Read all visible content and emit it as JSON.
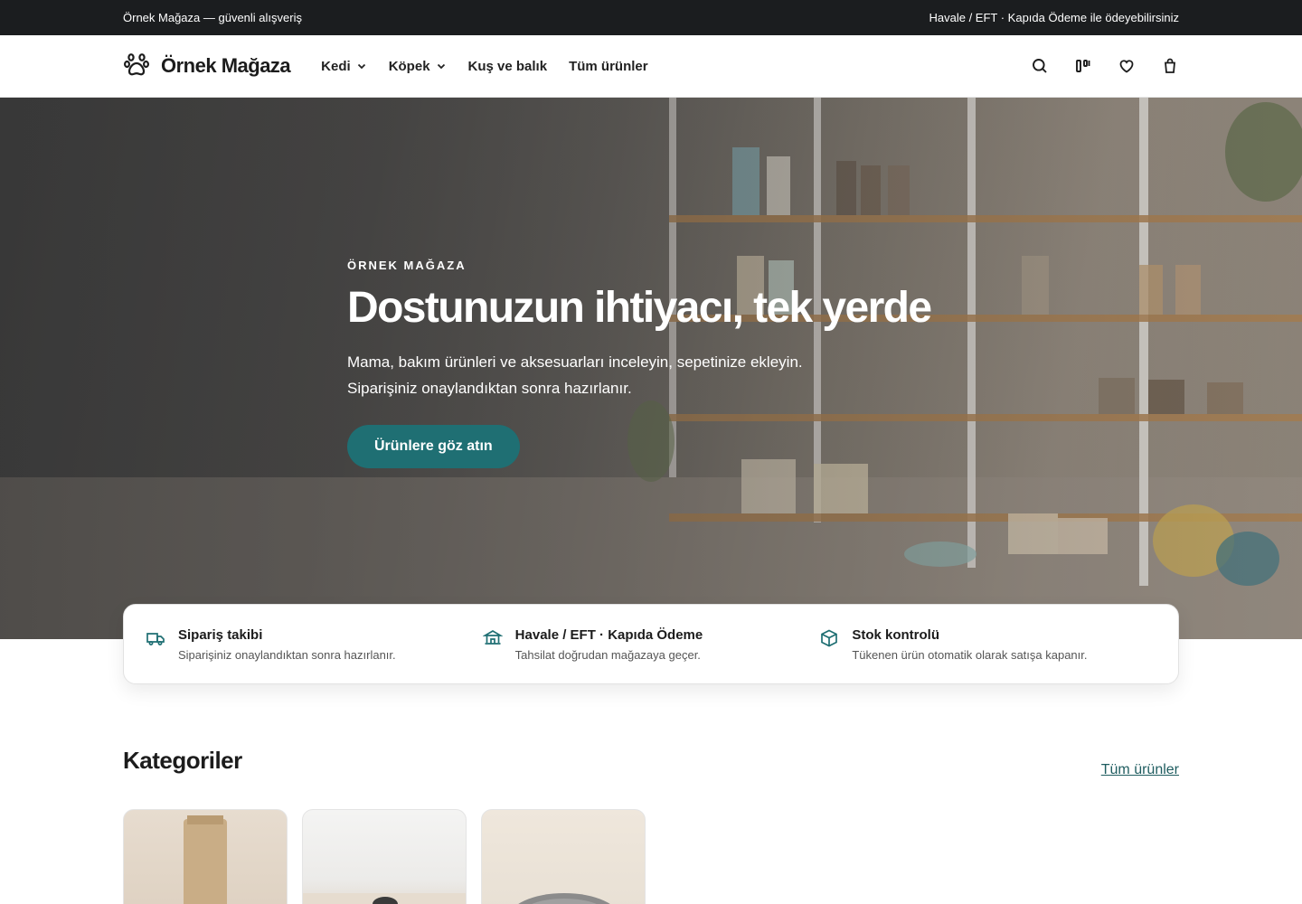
{
  "topbar": {
    "left_text": "Örnek Mağaza — güvenli alışveriş",
    "right_text": "Havale / EFT · Kapıda Ödeme ile ödeyebilirsiniz"
  },
  "header": {
    "brand": "Örnek Mağaza",
    "logo_icon": "paw-icon",
    "nav": [
      {
        "label": "Kedi",
        "has_dropdown": true
      },
      {
        "label": "Köpek",
        "has_dropdown": true
      },
      {
        "label": "Kuş ve balık",
        "has_dropdown": false
      },
      {
        "label": "Tüm ürünler",
        "has_dropdown": false
      }
    ],
    "icons": [
      "search-icon",
      "compare-icon",
      "heart-icon",
      "bag-icon"
    ]
  },
  "hero": {
    "eyebrow": "ÖRNEK MAĞAZA",
    "title": "Dostunuzun ihtiyacı, tek yerde",
    "subtitle_line1": "Mama, bakım ürünleri ve aksesuarları inceleyin, sepetinize ekleyin.",
    "subtitle_line2": "Siparişiniz onaylandıktan sonra hazırlanır.",
    "cta": "Ürünlere göz atın",
    "cta_color": "#1f6f73"
  },
  "features": [
    {
      "icon": "truck-icon",
      "title": "Sipariş takibi",
      "desc": "Siparişiniz onaylandıktan sonra hazırlanır."
    },
    {
      "icon": "bank-icon",
      "title": "Havale / EFT · Kapıda Ödeme",
      "desc": "Tahsilat doğrudan mağazaya geçer."
    },
    {
      "icon": "box-icon",
      "title": "Stok kontrolü",
      "desc": "Tükenen ürün otomatik olarak satışa kapanır."
    }
  ],
  "categories": {
    "title": "Kategoriler",
    "link": "Tüm ürünler"
  },
  "colors": {
    "accent": "#1f6f73",
    "topbar_bg": "#1b1d1f",
    "link": "#1f5d60"
  }
}
